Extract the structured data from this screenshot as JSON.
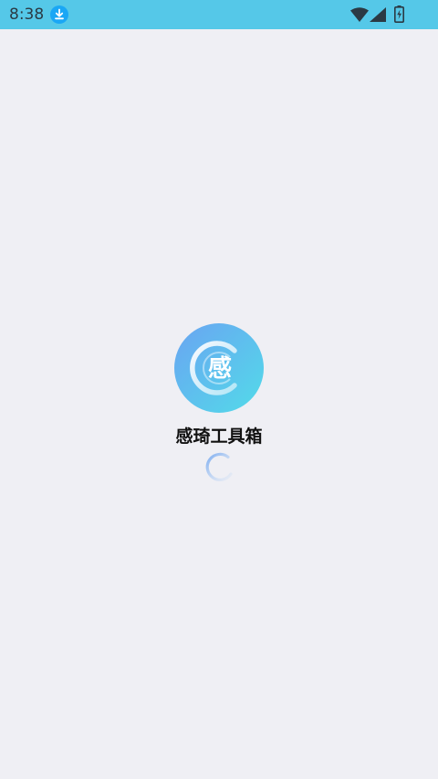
{
  "status_bar": {
    "time": "8:38",
    "background": "#55c8e8",
    "icons": [
      "download-icon",
      "wifi-icon",
      "signal-icon",
      "battery-charging-icon"
    ]
  },
  "splash": {
    "background": "#efeff4",
    "logo_char": "感",
    "app_name": "感琦工具箱",
    "logo_colors": [
      "#6aa8f0",
      "#55d4ea"
    ],
    "spinner_color": "#8fb8ee"
  }
}
